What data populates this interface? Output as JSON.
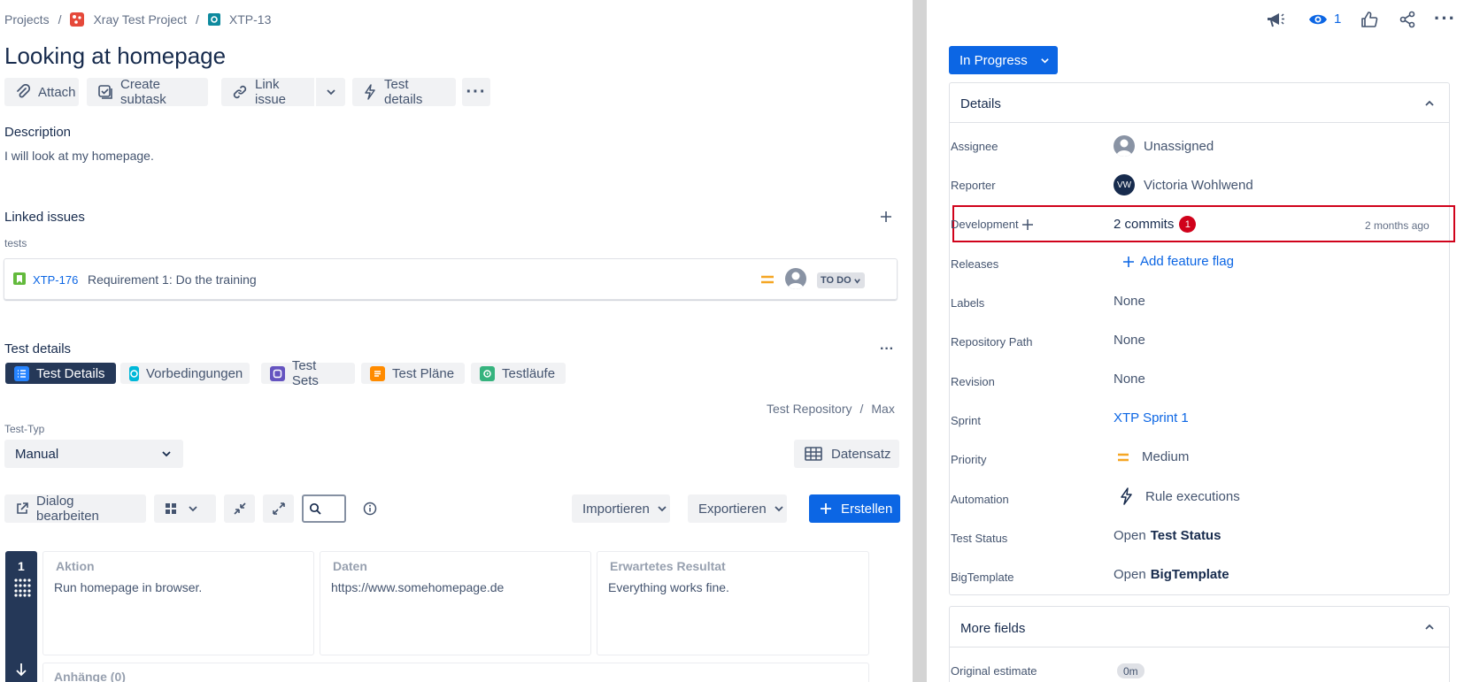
{
  "breadcrumb": {
    "projects": "Projects",
    "sep": "/",
    "project": "Xray Test Project",
    "issue_key": "XTP-13"
  },
  "issue": {
    "title": "Looking at homepage"
  },
  "toolbar": {
    "attach": "Attach",
    "create_subtask": "Create subtask",
    "link_issue": "Link issue",
    "test_details": "Test details"
  },
  "description": {
    "heading": "Description",
    "text": "I will look at my homepage."
  },
  "linked_issues": {
    "heading": "Linked issues",
    "group": "tests",
    "items": [
      {
        "key": "XTP-176",
        "summary": "Requirement 1: Do the training",
        "status": "TO DO"
      }
    ]
  },
  "test_details": {
    "heading": "Test details",
    "tabs": [
      "Test Details",
      "Vorbedingungen",
      "Test Sets",
      "Test Pläne",
      "Testläufe"
    ],
    "repo_path": {
      "root": "Test Repository",
      "sep": "/",
      "folder": "Max"
    },
    "test_type_label": "Test-Typ",
    "test_type_value": "Manual",
    "datensatz": "Datensatz",
    "edit_dialog": "Dialog bearbeiten",
    "import": "Importieren",
    "export": "Exportieren",
    "create": "Erstellen",
    "steps": [
      {
        "index": "1",
        "columns": [
          "Aktion",
          "Daten",
          "Erwartetes Resultat"
        ],
        "values": [
          "Run homepage in browser.",
          "https://www.somehomepage.de",
          "Everything works fine."
        ],
        "attachments": "Anhänge (0)"
      }
    ]
  },
  "header_actions": {
    "watch_count": "1"
  },
  "status_button": "In Progress",
  "details": {
    "heading": "Details",
    "assignee": {
      "label": "Assignee",
      "value": "Unassigned"
    },
    "reporter": {
      "label": "Reporter",
      "initials": "VW",
      "value": "Victoria Wohlwend"
    },
    "development": {
      "label": "Development",
      "value": "2 commits",
      "badge": "1",
      "time": "2 months ago"
    },
    "releases": {
      "label": "Releases",
      "value": "Add feature flag"
    },
    "labels": {
      "label": "Labels",
      "value": "None"
    },
    "repository_path": {
      "label": "Repository Path",
      "value": "None"
    },
    "revision": {
      "label": "Revision",
      "value": "None"
    },
    "sprint": {
      "label": "Sprint",
      "value": "XTP Sprint 1"
    },
    "priority": {
      "label": "Priority",
      "value": "Medium"
    },
    "automation": {
      "label": "Automation",
      "value": "Rule executions"
    },
    "test_status": {
      "label": "Test Status",
      "prefix": "Open",
      "value": "Test Status"
    },
    "big_template": {
      "label": "BigTemplate",
      "prefix": "Open",
      "value": "BigTemplate"
    }
  },
  "more_fields": {
    "heading": "More fields",
    "original_estimate": {
      "label": "Original estimate",
      "value": "0m"
    }
  },
  "colors": {
    "primary": "#0c66e4",
    "highlight": "#d0021b",
    "priority_medium": "#f5a623"
  }
}
